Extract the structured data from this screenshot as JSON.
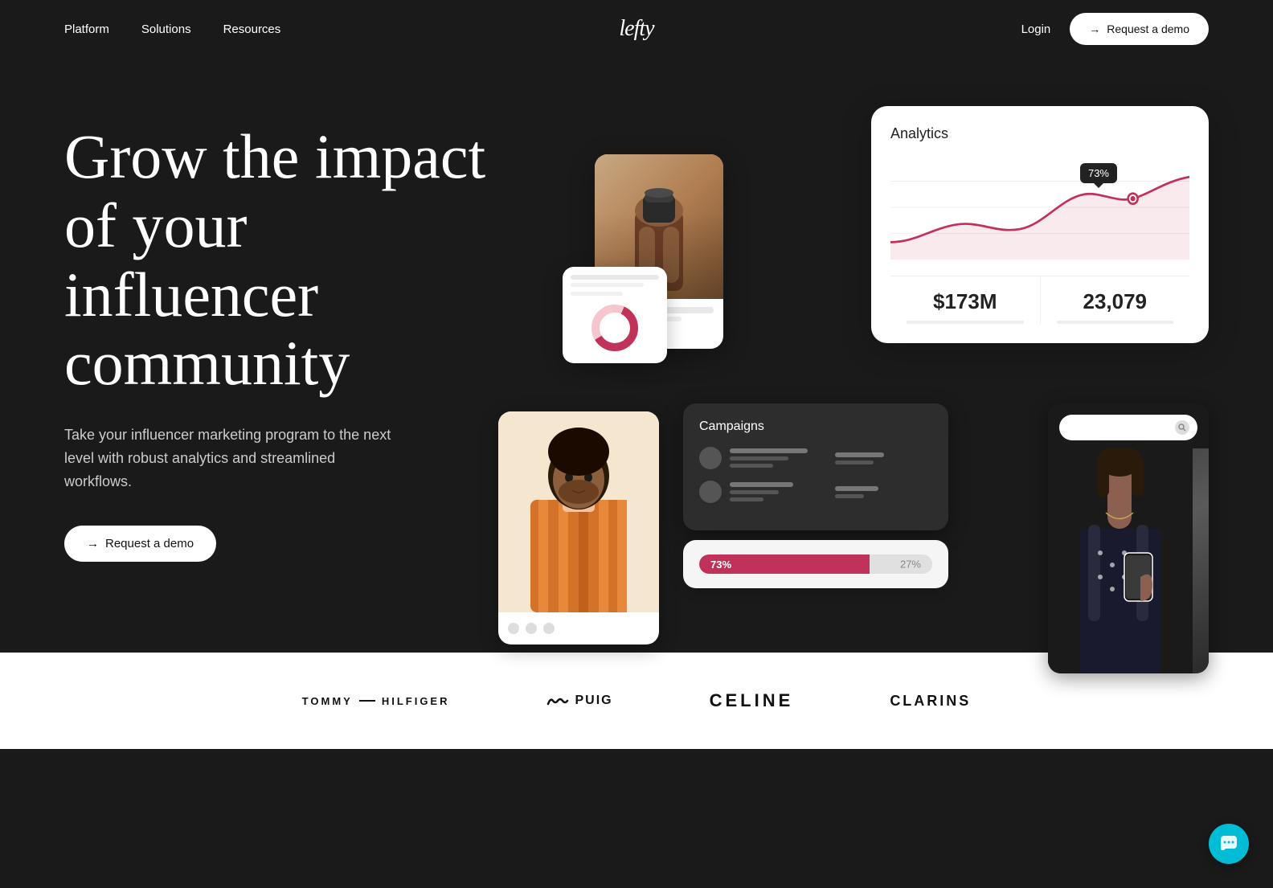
{
  "nav": {
    "links": [
      {
        "label": "Platform",
        "id": "platform"
      },
      {
        "label": "Solutions",
        "id": "solutions"
      },
      {
        "label": "Resources",
        "id": "resources"
      }
    ],
    "logo": "lefty",
    "login_label": "Login",
    "demo_label": "Request a demo",
    "arrow": "→"
  },
  "hero": {
    "title": "Grow the impact of your influencer community",
    "subtitle": "Take your influencer marketing program to the next level with robust analytics and streamlined workflows.",
    "cta_label": "Request a demo",
    "cta_arrow": "→"
  },
  "analytics_card": {
    "title": "Analytics",
    "tooltip": "73%",
    "stat1_value": "$173M",
    "stat2_value": "23,079"
  },
  "campaigns_card": {
    "title": "Campaigns"
  },
  "progress_card": {
    "left_label": "73%",
    "right_label": "27%",
    "fill_width": "73"
  },
  "brands": [
    {
      "label": "TOMMY HILFIGER",
      "id": "tommy"
    },
    {
      "label": "PUIG",
      "id": "puig"
    },
    {
      "label": "CELINE",
      "id": "celine"
    },
    {
      "label": "CLARINS",
      "id": "clarins"
    }
  ],
  "icons": {
    "search": "🔍",
    "arrow_right": "→",
    "chat": "💬"
  }
}
